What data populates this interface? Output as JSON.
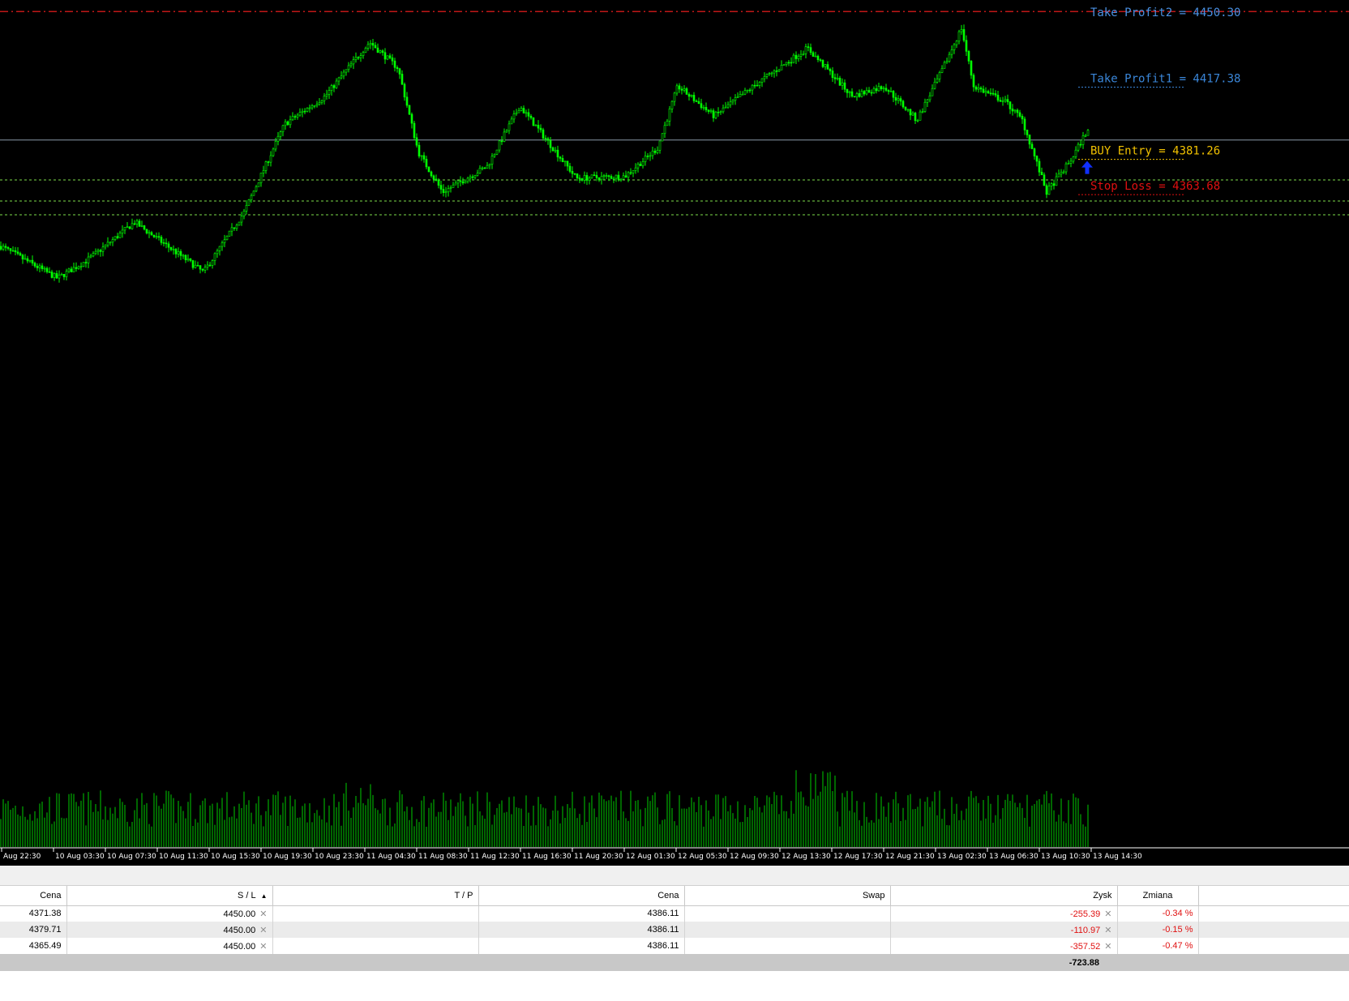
{
  "chart": {
    "background": "#000000",
    "candle_color": "#00ff00",
    "volume_color": "#00cc00",
    "price_range": [
      4290,
      4452
    ],
    "levels": [
      {
        "name": "take-profit-2",
        "label": "Take Profit2 = 4450.30",
        "price": 4450.3,
        "color": "#4a90e2",
        "line_color": "#ff2020",
        "line_style": "dashdot"
      },
      {
        "name": "take-profit-1",
        "label": "Take Profit1 = 4417.38",
        "price": 4417.38,
        "color": "#3a86d8",
        "line_color": "#3a86d8",
        "line_style": "dotted-short"
      },
      {
        "name": "buy-entry",
        "label": "BUY Entry = 4381.26",
        "price": 4381.26,
        "color": "#f0c000",
        "line_color": "#f0c000",
        "line_style": "dotted-short"
      },
      {
        "name": "stop-loss",
        "label": "Stop Loss = 4363.68",
        "price": 4363.68,
        "color": "#e01010",
        "line_color": "#e01010",
        "line_style": "dotted-short"
      }
    ],
    "bid_line_price": 4386.11,
    "signal": {
      "type": "buy-arrow",
      "color": "#1030ff"
    },
    "time_labels": [
      "Aug 22:30",
      "10 Aug 03:30",
      "10 Aug 07:30",
      "10 Aug 11:30",
      "10 Aug 15:30",
      "10 Aug 19:30",
      "10 Aug 23:30",
      "11 Aug 04:30",
      "11 Aug 08:30",
      "11 Aug 12:30",
      "11 Aug 16:30",
      "11 Aug 20:30",
      "12 Aug 01:30",
      "12 Aug 05:30",
      "12 Aug 09:30",
      "12 Aug 13:30",
      "12 Aug 17:30",
      "12 Aug 21:30",
      "13 Aug 02:30",
      "13 Aug 06:30",
      "13 Aug 10:30",
      "13 Aug 14:30"
    ]
  },
  "terminal": {
    "columns": [
      "Cena",
      "S / L",
      "T / P",
      "Cena",
      "Swap",
      "Zysk",
      "Zmiana"
    ],
    "rows": [
      {
        "open_price": "4371.38",
        "sl": "4450.00",
        "tp": "",
        "price": "4386.11",
        "swap": "",
        "profit": "-255.39",
        "change": "-0.34 %"
      },
      {
        "open_price": "4379.71",
        "sl": "4450.00",
        "tp": "",
        "price": "4386.11",
        "swap": "",
        "profit": "-110.97",
        "change": "-0.15 %"
      },
      {
        "open_price": "4365.49",
        "sl": "4450.00",
        "tp": "",
        "price": "4386.11",
        "swap": "",
        "profit": "-357.52",
        "change": "-0.47 %"
      }
    ],
    "total_profit": "-723.88"
  }
}
